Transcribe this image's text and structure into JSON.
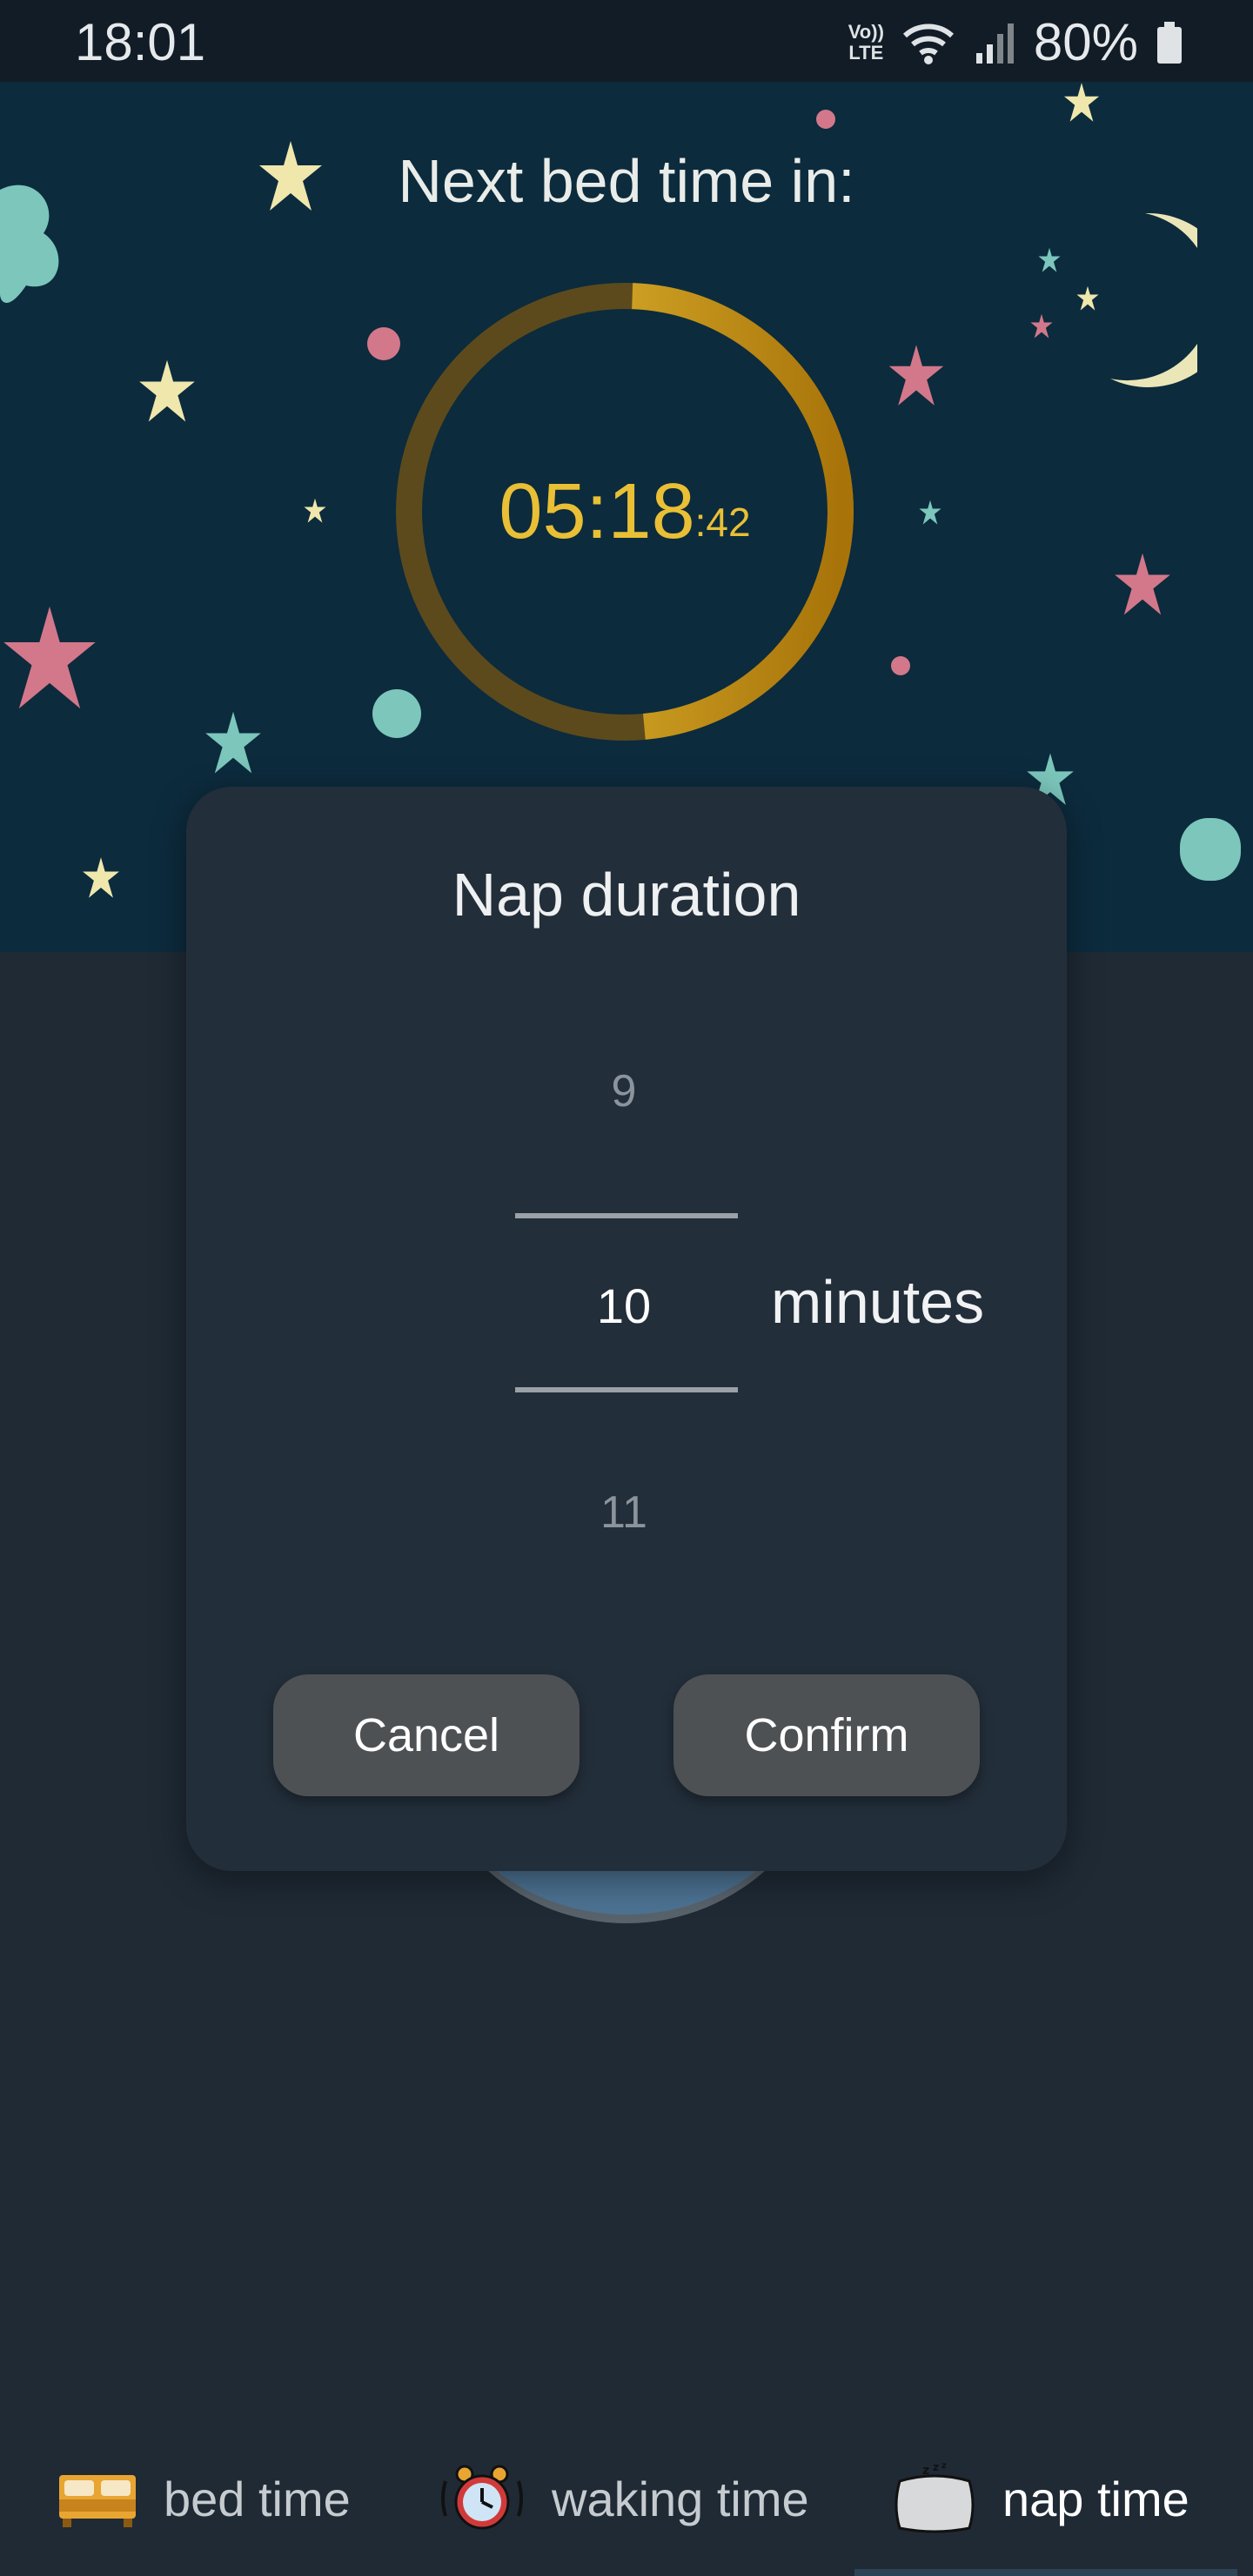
{
  "status_bar": {
    "time": "18:01",
    "volte_top": "Vo))",
    "volte_bottom": "LTE",
    "battery": "80%",
    "icons": [
      "volte-icon",
      "wifi-icon",
      "signal-icon",
      "battery-icon"
    ]
  },
  "countdown": {
    "title": "Next bed time in:",
    "time_main": "05:18",
    "time_seconds": ":42",
    "progress_fraction": 0.48,
    "colors": {
      "track": "#5c4a1c",
      "fill_start": "#f0c83a",
      "fill_end": "#a8740a",
      "text": "#e9bf35"
    }
  },
  "dialog": {
    "title": "Nap duration",
    "picker": {
      "previous": "9",
      "current": "10",
      "next": "11"
    },
    "unit": "minutes",
    "cancel_label": "Cancel",
    "confirm_label": "Confirm"
  },
  "bottom_nav": {
    "items": [
      {
        "label": "bed time",
        "icon": "bed-icon",
        "active": false
      },
      {
        "label": "waking time",
        "icon": "alarm-clock-icon",
        "active": false
      },
      {
        "label": "nap time",
        "icon": "pillow-icon",
        "active": true
      }
    ]
  }
}
